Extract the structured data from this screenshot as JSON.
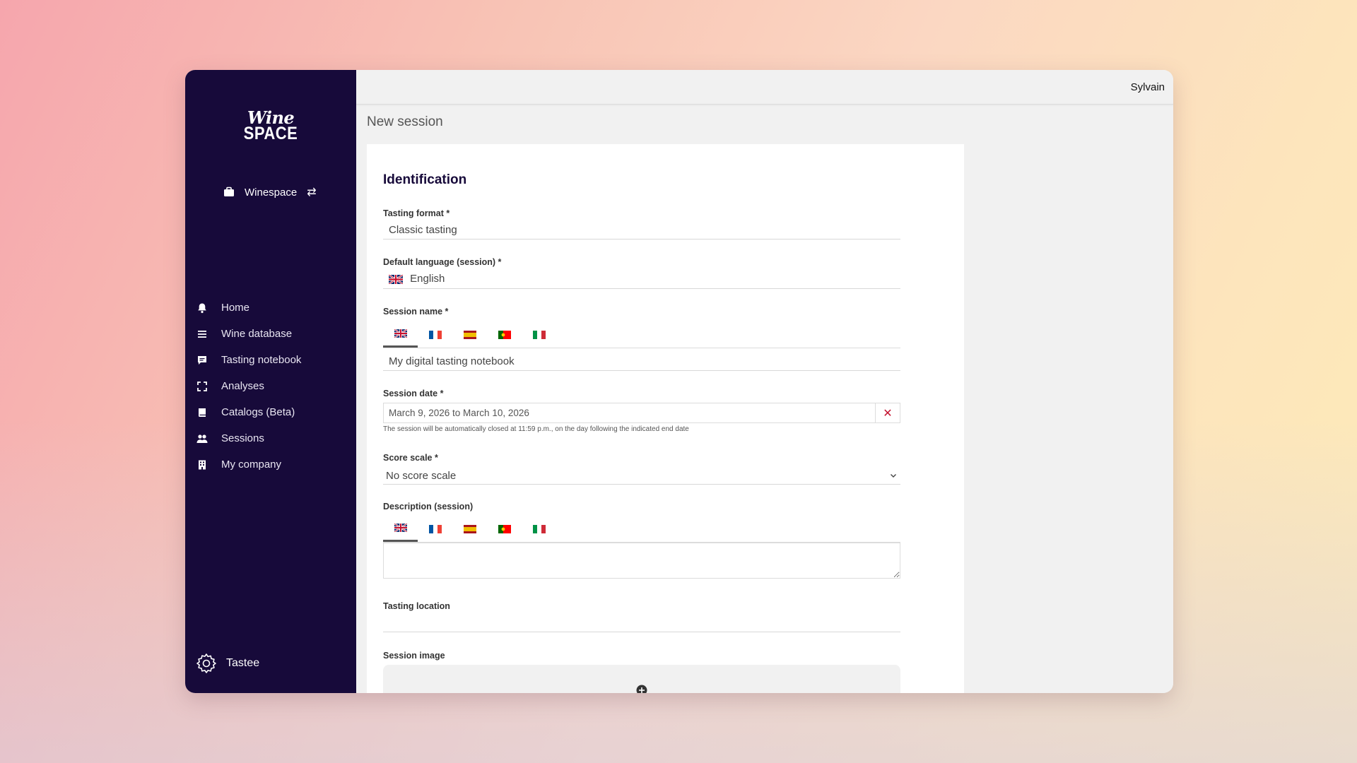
{
  "brand": {
    "logo_line1": "Wine",
    "logo_line2": "SPACE"
  },
  "sidebar": {
    "workspace_label": "Winespace",
    "items": [
      {
        "label": "Home",
        "icon": "bell-icon"
      },
      {
        "label": "Wine database",
        "icon": "list-icon"
      },
      {
        "label": "Tasting notebook",
        "icon": "comment-icon"
      },
      {
        "label": "Analyses",
        "icon": "expand-icon"
      },
      {
        "label": "Catalogs (Beta)",
        "icon": "book-icon"
      },
      {
        "label": "Sessions",
        "icon": "users-icon"
      },
      {
        "label": "My company",
        "icon": "building-icon"
      }
    ],
    "footer_label": "Tastee"
  },
  "header": {
    "user_name": "Sylvain"
  },
  "page": {
    "title": "New session"
  },
  "form": {
    "section_title": "Identification",
    "tasting_format": {
      "label": "Tasting format *",
      "value": "Classic tasting"
    },
    "default_language": {
      "label": "Default language (session) *",
      "value": "English"
    },
    "session_name": {
      "label": "Session name *",
      "value": "My digital tasting notebook"
    },
    "session_date": {
      "label": "Session date *",
      "value": "March 9, 2026 to March 10, 2026",
      "hint": "The session will be automatically closed at 11:59 p.m., on the day following the indicated end date"
    },
    "score_scale": {
      "label": "Score scale *",
      "value": "No score scale"
    },
    "description": {
      "label": "Description (session)",
      "value": ""
    },
    "tasting_location": {
      "label": "Tasting location",
      "value": ""
    },
    "session_image": {
      "label": "Session image"
    }
  },
  "colors": {
    "sidebar_bg": "#170a3a",
    "accent_red": "#c4122f",
    "page_bg": "#f1f1f1"
  }
}
